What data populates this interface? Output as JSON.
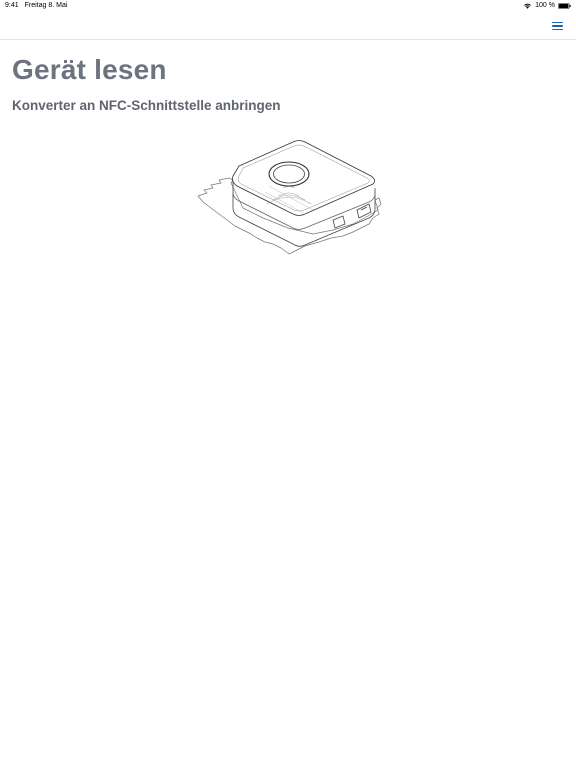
{
  "status_bar": {
    "time": "9:41",
    "date": "Freitag 8. Mai",
    "battery": "100 %"
  },
  "nav": {
    "menu_icon": "hamburger-menu-icon",
    "accent_color": "#1a5fb4"
  },
  "main": {
    "title": "Gerät lesen",
    "subtitle": "Konverter an NFC-Schnittstelle anbringen",
    "illustration": "nfc-converter-device-icon"
  }
}
